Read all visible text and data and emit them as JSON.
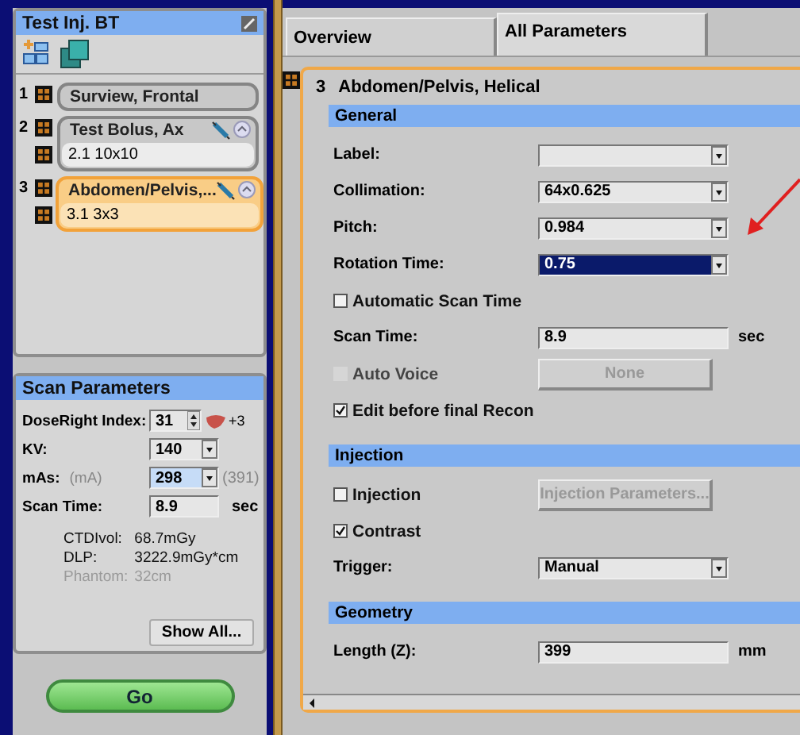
{
  "protocol_panel": {
    "title": "Test Inj. BT",
    "scans": [
      {
        "number": "1",
        "name": "Surview, Frontal",
        "selected": false,
        "injection": false
      },
      {
        "number": "2",
        "name": "Test Bolus, Ax",
        "selected": false,
        "injection": true,
        "recons": [
          "2.1 10x10"
        ]
      },
      {
        "number": "3",
        "name": "Abdomen/Pelvis,...",
        "selected": true,
        "injection": true,
        "recons": [
          "3.1 3x3"
        ]
      }
    ]
  },
  "scan_parameters": {
    "title": "Scan Parameters",
    "rows": [
      {
        "kind": "spinner",
        "label": "DoseRight Index:",
        "value": "31",
        "badge": "+3"
      },
      {
        "kind": "dropdown",
        "label": "KV:",
        "value": "140",
        "selected": false
      },
      {
        "kind": "dropdown",
        "label": "mAs:",
        "hint": "(mA)",
        "value": "298",
        "selected": true,
        "note": "(391)"
      },
      {
        "kind": "text",
        "label": "Scan Time:",
        "value": "8.9",
        "unit": "sec"
      }
    ],
    "dose": [
      {
        "label": "CTDIvol:",
        "value": "68.7mGy",
        "dimmed": false
      },
      {
        "label": "DLP:",
        "value": "3222.9mGy*cm",
        "dimmed": false
      },
      {
        "label": "Phantom:",
        "value": "32cm",
        "dimmed": true
      }
    ],
    "show_all_button": "Show All...",
    "go_button": "Go"
  },
  "tabs": [
    {
      "label": "Overview",
      "selected": false
    },
    {
      "label": "All Parameters",
      "selected": true
    }
  ],
  "scan_detail": {
    "number": "3",
    "title": "Abdomen/Pelvis, Helical",
    "sections": [
      {
        "title": "General",
        "rows": [
          {
            "kind": "dropdown",
            "label": "Label:",
            "selected": false
          },
          {
            "kind": "dropdown",
            "label": "Collimation:",
            "value": "64x0.625",
            "selected": false
          },
          {
            "kind": "dropdown",
            "label": "Pitch:",
            "value": "0.984",
            "selected": false
          },
          {
            "kind": "dropdown",
            "label": "Rotation Time:",
            "value": "0.75",
            "selected": true
          },
          {
            "kind": "checkbox",
            "label": "Automatic Scan Time",
            "checked": false,
            "disabled": false
          },
          {
            "kind": "text",
            "label": "Scan Time:",
            "value": "8.9",
            "unit": "sec"
          },
          {
            "kind": "checkbox",
            "label": "Auto Voice",
            "checked": false,
            "disabled": true,
            "button": {
              "label": "None",
              "disabled": true
            }
          },
          {
            "kind": "checkbox",
            "label": "Edit before final Recon",
            "checked": true,
            "disabled": false
          }
        ]
      },
      {
        "title": "Injection",
        "rows": [
          {
            "kind": "checkbox",
            "label": "Injection",
            "checked": false,
            "disabled": false,
            "button": {
              "label": "Injection Parameters...",
              "disabled": true
            }
          },
          {
            "kind": "checkbox",
            "label": "Contrast",
            "checked": true,
            "disabled": false
          },
          {
            "kind": "dropdown",
            "label": "Trigger:",
            "value": "Manual",
            "selected": false
          }
        ]
      },
      {
        "title": "Geometry",
        "rows": [
          {
            "kind": "text",
            "label": "Length (Z):",
            "value": "399",
            "unit": "mm"
          }
        ]
      }
    ]
  }
}
